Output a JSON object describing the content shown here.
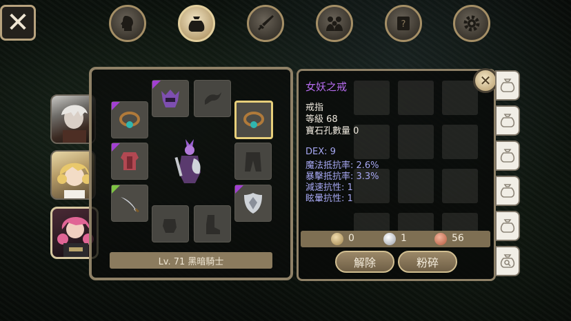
{
  "nav": {
    "close_label": "✕",
    "tabs": [
      {
        "icon": "head-icon",
        "active": false
      },
      {
        "icon": "bag-icon",
        "active": true
      },
      {
        "icon": "sword-icon",
        "active": false
      },
      {
        "icon": "party-icon",
        "active": false
      },
      {
        "icon": "scroll-icon",
        "active": false
      },
      {
        "icon": "gear-icon",
        "active": false
      }
    ]
  },
  "characters": [
    {
      "name": "white-haired-warrior"
    },
    {
      "name": "blonde-girl"
    },
    {
      "name": "pink-haired-dark-knight",
      "selected": true
    }
  ],
  "equipment": {
    "slots": [
      {
        "slot": "helmet",
        "item": "purple-helmet-icon",
        "rarity": "purple"
      },
      {
        "slot": "cloak",
        "item": "empty-cloak-icon",
        "rarity": null
      },
      {
        "slot": "necklace",
        "item": "ring-icon",
        "rarity": "purple"
      },
      {
        "slot": "ring",
        "item": "ring-icon",
        "rarity": null,
        "selected": true
      },
      {
        "slot": "armor",
        "item": "red-armor-icon",
        "rarity": "purple"
      },
      {
        "slot": "pants",
        "item": "empty-pants-icon",
        "rarity": null
      },
      {
        "slot": "weapon",
        "item": "curved-sword-icon",
        "rarity": "green"
      },
      {
        "slot": "shield",
        "item": "shield-icon",
        "rarity": "purple"
      },
      {
        "slot": "gloves",
        "item": "empty-gloves-icon",
        "rarity": null
      },
      {
        "slot": "boots",
        "item": "empty-boots-icon",
        "rarity": null
      }
    ],
    "level_label": "Lv. 71 黑暗騎士"
  },
  "detail": {
    "title": "女妖之戒",
    "type": "戒指",
    "level": "等級 68",
    "gem_slots": "寶石孔數量 0",
    "stats": [
      "DEX: 9",
      "魔法抵抗率: 2.6%",
      "暴擊抵抗率: 3.3%",
      "減速抗性: 1",
      "眩暈抗性: 1"
    ],
    "close_label": "✕"
  },
  "currency": {
    "gold": "0",
    "silver": "1",
    "copper": "56"
  },
  "actions": {
    "unequip": "解除",
    "smash": "粉碎"
  },
  "side_tabs": [
    "bag-icon",
    "bag-icon",
    "bag-icon",
    "bag-icon",
    "bag-icon",
    "bag-search-icon"
  ],
  "colors": {
    "item_title": "#b76cf0",
    "stat_text": "#a7a8f3",
    "rarity_purple": "#a240d2",
    "rarity_green": "#7ec443"
  }
}
